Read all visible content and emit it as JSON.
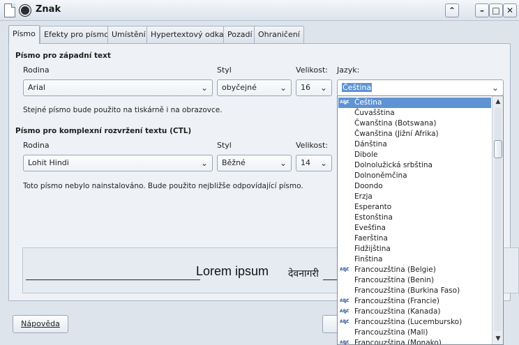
{
  "window": {
    "title": "Znak"
  },
  "tabs": [
    "Písmo",
    "Efekty pro písmo",
    "Umístění",
    "Hypertextový odkaz",
    "Pozadí",
    "Ohraničení"
  ],
  "western": {
    "section_title": "Písmo pro západní text",
    "family_label": "Rodina",
    "style_label": "Styl",
    "size_label": "Velikost:",
    "language_label": "Jazyk:",
    "family_value": "Arial",
    "style_value": "obyčejné",
    "size_value": "16",
    "language_value": "Čeština",
    "note": "Stejné písmo bude použito na tiskárně i na obrazovce."
  },
  "ctl": {
    "section_title": "Písmo pro komplexní rozvržení textu (CTL)",
    "family_label": "Rodina",
    "style_label": "Styl",
    "size_label": "Velikost:",
    "family_value": "Lohit Hindi",
    "style_value": "Běžné",
    "size_value": "14",
    "note": "Toto písmo nebylo nainstalováno. Bude použito nejbližše odpovídající písmo."
  },
  "preview": {
    "latin": "Lorem ipsum",
    "devanagari": "देवनागरी"
  },
  "buttons": {
    "help": "Nápověda"
  },
  "language_list": {
    "items": [
      {
        "label": "Čeština",
        "spell": true,
        "selected": true
      },
      {
        "label": "Čuvašština",
        "spell": false
      },
      {
        "label": "Čwanština (Botswana)",
        "spell": false
      },
      {
        "label": "Čwanština (Jižní Afrika)",
        "spell": false
      },
      {
        "label": "Dánština",
        "spell": false
      },
      {
        "label": "Dibole",
        "spell": false
      },
      {
        "label": "Dolnolužická srbština",
        "spell": false
      },
      {
        "label": "Dolnoněmčina",
        "spell": false
      },
      {
        "label": "Doondo",
        "spell": false
      },
      {
        "label": "Erzja",
        "spell": false
      },
      {
        "label": "Esperanto",
        "spell": false
      },
      {
        "label": "Estonština",
        "spell": false
      },
      {
        "label": "Evešťina",
        "spell": false
      },
      {
        "label": "Faerština",
        "spell": false
      },
      {
        "label": "Fidžijština",
        "spell": false
      },
      {
        "label": "Finština",
        "spell": false
      },
      {
        "label": "Francouzština (Belgie)",
        "spell": true
      },
      {
        "label": "Francouzština (Benin)",
        "spell": false
      },
      {
        "label": "Francouzština (Burkina Faso)",
        "spell": false
      },
      {
        "label": "Francouzština (Francie)",
        "spell": true
      },
      {
        "label": "Francouzština (Kanada)",
        "spell": true
      },
      {
        "label": "Francouzština (Lucembursko)",
        "spell": true
      },
      {
        "label": "Francouzština (Mali)",
        "spell": false
      },
      {
        "label": "Francouzština (Monako)",
        "spell": true
      }
    ]
  },
  "icons": {
    "spell_text": "ABC",
    "check": "✓"
  }
}
